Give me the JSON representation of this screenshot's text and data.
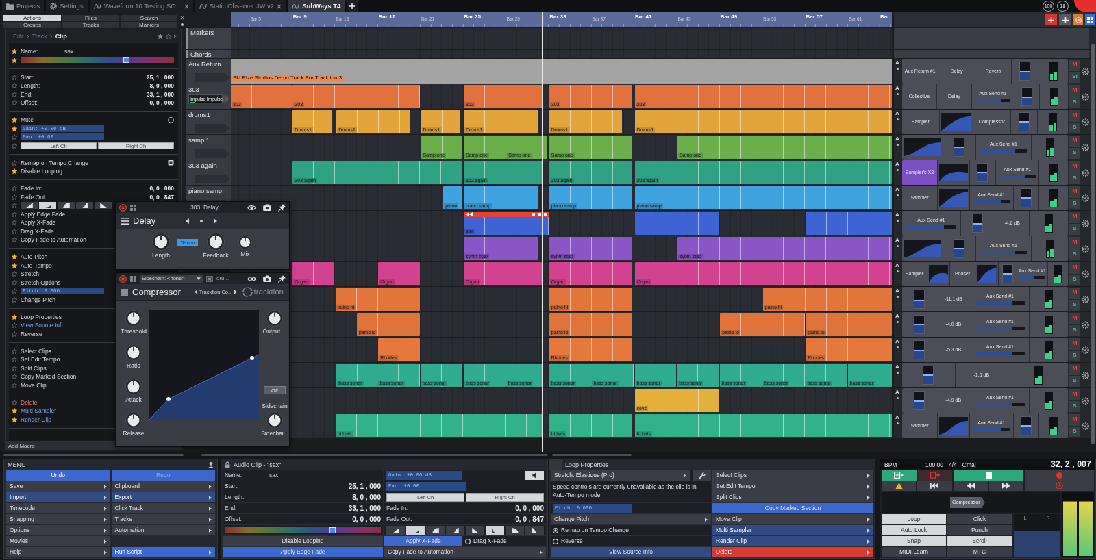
{
  "tabs_bar": {
    "tabs": [
      {
        "kind": "projects",
        "label": "Projects",
        "selected": false
      },
      {
        "kind": "settings",
        "label": "Settings",
        "selected": false
      },
      {
        "kind": "edit",
        "label": "Waveform 10 Testing SO...",
        "selected": false
      },
      {
        "kind": "edit",
        "label": "Static Observer JW v2",
        "selected": false
      },
      {
        "kind": "edit",
        "label": "SubWays T4",
        "selected": true
      }
    ],
    "badges": [
      "100",
      "18"
    ]
  },
  "left_panel": {
    "subtabs": [
      {
        "label": "Actions",
        "selected": true
      },
      {
        "label": "Files",
        "selected": false
      },
      {
        "label": "Search",
        "selected": false
      },
      {
        "label": "Groups",
        "selected": false
      },
      {
        "label": "Tracks",
        "selected": false
      },
      {
        "label": "Markers",
        "selected": false
      }
    ],
    "breadcrumb": [
      "Edit",
      "Track",
      "Clip"
    ],
    "sections": [
      [
        {
          "kind": "name",
          "starred": true,
          "label": "Name:",
          "value": "sax"
        },
        {
          "kind": "color",
          "starred": true
        }
      ],
      [
        {
          "kind": "field",
          "starred": false,
          "label": "Start:",
          "value": "25, 1 , 000"
        },
        {
          "kind": "field",
          "starred": false,
          "label": "Length:",
          "value": "8, 0 , 000"
        },
        {
          "kind": "field",
          "starred": false,
          "label": "End:",
          "value": "33, 1 , 000"
        },
        {
          "kind": "field",
          "starred": false,
          "label": "Offset:",
          "value": "0, 0 , 000"
        }
      ],
      [
        {
          "kind": "toggle",
          "starred": true,
          "label": "Mute",
          "checked": false
        },
        {
          "kind": "valuebox",
          "starred": true,
          "label": "Gain: +0.00 dB"
        },
        {
          "kind": "valuebox",
          "starred": false,
          "label": "Pan: +0.00"
        },
        {
          "kind": "channels",
          "starred": false,
          "buttons": [
            "Left Ch",
            "Right Ch"
          ]
        }
      ],
      [
        {
          "kind": "toggle",
          "starred": false,
          "label": "Remap on Tempo Change",
          "checked": true
        },
        {
          "kind": "action",
          "starred": true,
          "label": "Disable Looping"
        }
      ],
      [
        {
          "kind": "field",
          "starred": false,
          "label": "Fade In:",
          "value": "0, 0 , 000"
        },
        {
          "kind": "field",
          "starred": false,
          "label": "Fade Out:",
          "value": "0, 0 , 847"
        },
        {
          "kind": "fades",
          "starred": false,
          "shapes": [
            {
              "selected": false
            },
            {
              "selected": true
            },
            {
              "selected": false
            },
            {
              "selected": false
            },
            {
              "selected": false
            }
          ]
        },
        {
          "kind": "action",
          "starred": false,
          "label": "Apply Edge Fade"
        },
        {
          "kind": "action",
          "starred": false,
          "label": "Apply X-Fade"
        },
        {
          "kind": "action",
          "starred": false,
          "label": "Drag X-Fade"
        },
        {
          "kind": "action",
          "starred": false,
          "label": "Copy Fade to Automation"
        }
      ],
      [
        {
          "kind": "action",
          "starred": true,
          "label": "Auto-Pitch"
        },
        {
          "kind": "action",
          "starred": true,
          "label": "Auto-Tempo"
        },
        {
          "kind": "action",
          "starred": false,
          "label": "Stretch"
        },
        {
          "kind": "action",
          "starred": false,
          "label": "Stretch Options"
        },
        {
          "kind": "valuebox",
          "starred": false,
          "label": "Pitch: 0.000"
        },
        {
          "kind": "action",
          "starred": false,
          "label": "Change Pitch"
        }
      ],
      [
        {
          "kind": "action",
          "starred": true,
          "label": "Loop Properties"
        },
        {
          "kind": "link",
          "starred": false,
          "label": "View Source Info"
        },
        {
          "kind": "action",
          "starred": false,
          "label": "Reverse"
        }
      ],
      [
        {
          "kind": "action",
          "starred": false,
          "label": "Select Clips"
        },
        {
          "kind": "action",
          "starred": false,
          "label": "Set Edit Tempo"
        },
        {
          "kind": "action",
          "starred": false,
          "label": "Split Clips"
        },
        {
          "kind": "action",
          "starred": false,
          "label": "Copy Marked Section"
        },
        {
          "kind": "action",
          "starred": false,
          "label": "Move Clip"
        }
      ],
      [
        {
          "kind": "danger",
          "starred": false,
          "label": "Delete"
        },
        {
          "kind": "link",
          "starred": true,
          "label": "Multi Sampler"
        },
        {
          "kind": "link",
          "starred": true,
          "label": "Render Clip"
        }
      ]
    ],
    "footer": "Add Macro"
  },
  "arrangement": {
    "ruler": [
      {
        "label": "Bar 5",
        "major": false
      },
      {
        "label": "Bar 9",
        "major": true
      },
      {
        "label": "Bar 13",
        "major": false
      },
      {
        "label": "Bar 17",
        "major": true
      },
      {
        "label": "Bar 21",
        "major": false
      },
      {
        "label": "Bar 25",
        "major": true
      },
      {
        "label": "Bar 29",
        "major": false
      },
      {
        "label": "Bar 33",
        "major": true
      },
      {
        "label": "Bar 37",
        "major": false
      },
      {
        "label": "Bar 41",
        "major": true
      },
      {
        "label": "Bar 45",
        "major": false
      },
      {
        "label": "Bar 49",
        "major": true
      },
      {
        "label": "Bar 53",
        "major": false
      },
      {
        "label": "Bar 57",
        "major": true
      },
      {
        "label": "Bar 61",
        "major": false
      },
      {
        "label": "Bar",
        "major": true
      }
    ],
    "tracks": [
      {
        "kind": "markers",
        "name": "Markers"
      },
      {
        "kind": "chords",
        "name": "Chords"
      },
      {
        "kind": "aux",
        "name": "Aux Return",
        "color": "#a4a4a4",
        "banner": "Ski Rize Studios Demo Track For Tracktion 3",
        "mixer": {
          "automation": "A",
          "slots": [
            {
              "kind": "plugin",
              "label": "Aux Return #1"
            },
            {
              "kind": "plugin",
              "label": "Delay"
            },
            {
              "kind": "plugin",
              "label": "Reverb"
            },
            {
              "kind": "fader",
              "level": 0.55
            },
            {
              "kind": "meter"
            }
          ],
          "mute": "M",
          "solo": "SI"
        }
      },
      {
        "kind": "audio",
        "name": "303",
        "input": "Impulse Impulse",
        "color": "#e2713d",
        "clips": [
          {
            "label": "303",
            "selected": false
          },
          {
            "label": "303",
            "selected": false
          },
          {
            "label": "303",
            "selected": false
          },
          {
            "label": "303",
            "selected": false
          },
          {
            "label": "303",
            "selected": false
          }
        ],
        "mixer": {
          "automation": "A",
          "slots": [
            {
              "kind": "plugin",
              "label": "Collective"
            },
            {
              "kind": "plugin",
              "label": "Delay"
            },
            {
              "kind": "send",
              "label": "Aux Send #1",
              "level": 0.75
            },
            {
              "kind": "fader",
              "level": 0.5
            },
            {
              "kind": "meter"
            }
          ],
          "mute": "M",
          "solo": "S"
        }
      },
      {
        "kind": "audio",
        "name": "drums1",
        "color": "#e3a43c",
        "clips": [
          {
            "label": "Drums1",
            "selected": false
          },
          {
            "label": "Drums1",
            "selected": false
          },
          {
            "label": "Drums1",
            "selected": false
          },
          {
            "label": "Drums1",
            "selected": false
          },
          {
            "label": "Drums1",
            "selected": false
          },
          {
            "label": "Drums1",
            "selected": false
          }
        ],
        "mixer": {
          "automation": "A",
          "slots": [
            {
              "kind": "plugin",
              "label": "Sampler"
            },
            {
              "kind": "graph"
            },
            {
              "kind": "plugin",
              "label": "Compressor"
            },
            {
              "kind": "fader",
              "level": 0.55
            },
            {
              "kind": "meter"
            }
          ],
          "mute": "M",
          "solo": "S"
        }
      },
      {
        "kind": "audio",
        "name": "samp 1",
        "color": "#6cae4a",
        "clips": [
          {
            "label": "Samp one",
            "selected": false
          },
          {
            "label": "Samp one",
            "selected": false
          },
          {
            "label": "Samp one",
            "selected": false
          },
          {
            "label": "Samp one",
            "selected": false
          },
          {
            "label": "Samp one",
            "selected": false
          }
        ],
        "mixer": {
          "automation": "A",
          "slots": [
            {
              "kind": "graph"
            },
            {
              "kind": "fader",
              "level": 0.55
            },
            {
              "kind": "send",
              "label": "Aux Send #1",
              "level": 0.75
            },
            {
              "kind": "meter"
            }
          ],
          "mute": "M",
          "solo": "S"
        }
      },
      {
        "kind": "audio",
        "name": "303 again",
        "color": "#2fa283",
        "clips": [
          {
            "label": "303 again",
            "selected": false
          },
          {
            "label": "303 again",
            "selected": false
          },
          {
            "label": "303 again",
            "selected": false
          },
          {
            "label": "303 again",
            "selected": false
          }
        ],
        "mixer": {
          "automation": "A",
          "slots": [
            {
              "kind": "plugin",
              "label": "Sampler's X3",
              "color": "#7d4fc4"
            },
            {
              "kind": "graph"
            },
            {
              "kind": "fader",
              "level": 0.55
            },
            {
              "kind": "send",
              "label": "Aux Send #1",
              "level": 0.7
            },
            {
              "kind": "meter"
            }
          ],
          "mute": "M",
          "solo": "S"
        }
      },
      {
        "kind": "audio",
        "name": "piano samp",
        "color": "#3ea3df",
        "clips": [
          {
            "label": "piano",
            "selected": false
          },
          {
            "label": "piano samp",
            "selected": false
          },
          {
            "label": "piano samp",
            "selected": false
          },
          {
            "label": "piano samp",
            "selected": false
          }
        ],
        "mixer": {
          "automation": "A",
          "slots": [
            {
              "kind": "plugin",
              "label": "Sampler"
            },
            {
              "kind": "graph"
            },
            {
              "kind": "send",
              "label": "Aux Send #1",
              "level": 0.75
            },
            {
              "kind": "fader",
              "level": 0.55
            },
            {
              "kind": "meter"
            }
          ],
          "mute": "M",
          "solo": "S"
        }
      },
      {
        "kind": "audio",
        "color": "#3d63d4",
        "clips": [
          {
            "label": "sax",
            "selected": true
          },
          {
            "selected": false
          },
          {
            "selected": false
          }
        ],
        "mixer": {
          "automation": "A",
          "slots": [
            {
              "kind": "send",
              "label": "Aux Send #1",
              "level": 0.75
            },
            {
              "kind": "fader",
              "level": 0.5
            },
            {
              "kind": "reading",
              "label": "-4.6 dB"
            },
            {
              "kind": "meter"
            }
          ],
          "mute": "M",
          "solo": "S"
        }
      },
      {
        "kind": "audio",
        "color": "#8a55c6",
        "clips": [
          {
            "label": "synth stab",
            "selected": false
          },
          {
            "label": "synth stab",
            "selected": false
          },
          {
            "label": "synth stab",
            "selected": false
          }
        ],
        "mixer": {
          "automation": "A",
          "slots": [
            {
              "kind": "graph"
            },
            {
              "kind": "fader",
              "level": 0.55
            },
            {
              "kind": "send",
              "label": "Aux Send #1",
              "level": 0.75
            },
            {
              "kind": "meter"
            }
          ],
          "mute": "M",
          "solo": "S"
        }
      },
      {
        "kind": "audio",
        "color": "#d3428e",
        "clips": [
          {
            "label": "Organ",
            "selected": false
          },
          {
            "label": "Organ",
            "selected": false
          },
          {
            "label": "Organ",
            "selected": false
          },
          {
            "label": "Organ",
            "selected": false
          },
          {
            "label": "Organ",
            "selected": false
          }
        ],
        "mixer": {
          "automation": "A",
          "slots": [
            {
              "kind": "plugin",
              "label": "Sampler"
            },
            {
              "kind": "graph"
            },
            {
              "kind": "plugin",
              "label": "Phaser"
            },
            {
              "kind": "graph"
            },
            {
              "kind": "fader",
              "level": 0.55
            },
            {
              "kind": "send",
              "label": "Aux Send #1",
              "level": 0.6
            },
            {
              "kind": "meter"
            }
          ],
          "mute": "M",
          "solo": "S"
        }
      },
      {
        "kind": "audio",
        "color": "#e3753b",
        "clips": [
          {
            "label": "paino hi",
            "selected": false
          },
          {
            "label": "paino hi",
            "selected": false
          },
          {
            "label": "paino hi",
            "selected": false
          }
        ],
        "mixer": {
          "automation": "A",
          "slots": [
            {
              "kind": "fader",
              "level": 0.45
            },
            {
              "kind": "reading",
              "label": "-11.1 dB"
            },
            {
              "kind": "send",
              "label": "Aux Send #1",
              "level": 0.75
            },
            {
              "kind": "meter"
            }
          ],
          "mute": "M",
          "solo": "S"
        }
      },
      {
        "kind": "audio",
        "color": "#e0733a",
        "clips": [
          {
            "label": "paino lo",
            "selected": false
          },
          {
            "label": "paino lo",
            "selected": false
          },
          {
            "label": "paino lo",
            "selected": false
          },
          {
            "label": "paino lo",
            "selected": false
          }
        ],
        "mixer": {
          "automation": "A",
          "slots": [
            {
              "kind": "fader",
              "level": 0.55
            },
            {
              "kind": "reading",
              "label": "-4.0 dB"
            },
            {
              "kind": "send",
              "label": "Aux Send #1",
              "level": 0.75
            },
            {
              "kind": "meter"
            }
          ],
          "mute": "M",
          "solo": "S"
        }
      },
      {
        "kind": "audio",
        "color": "#e5783d",
        "clips": [
          {
            "label": "Rhodes",
            "selected": false
          },
          {
            "label": "Rhodes",
            "selected": false
          },
          {
            "label": "Rhodes",
            "selected": false
          }
        ],
        "mixer": {
          "automation": "A",
          "slots": [
            {
              "kind": "fader",
              "level": 0.5
            },
            {
              "kind": "reading",
              "label": "-5.3 dB"
            },
            {
              "kind": "send",
              "label": "Aux Send #1",
              "level": 0.75
            },
            {
              "kind": "meter"
            }
          ],
          "mute": "M",
          "solo": "S"
        }
      },
      {
        "kind": "audio",
        "color": "#2fab8f",
        "clips": [
          {
            "label": "bass sonar",
            "selected": false
          },
          {
            "label": "bass sonar",
            "selected": false
          },
          {
            "label": "bass sonar",
            "selected": false
          },
          {
            "label": "bass sonar",
            "selected": false
          },
          {
            "label": "bass sonar",
            "selected": false
          },
          {
            "label": "bass sonar",
            "selected": false
          },
          {
            "label": "bass sonar",
            "selected": false
          },
          {
            "label": "bass sonar",
            "selected": false
          },
          {
            "label": "bass sonar",
            "selected": false
          },
          {
            "label": "bass sonar",
            "selected": false
          },
          {
            "label": "bass sonar",
            "selected": false
          },
          {
            "label": "bass sonar",
            "selected": false
          },
          {
            "label": "bass sonar",
            "selected": false
          }
        ],
        "mixer": {
          "automation": "A",
          "slots": [
            {
              "kind": "fader",
              "level": 0.55
            },
            {
              "kind": "reading",
              "label": "-1.5 dB"
            },
            {
              "kind": "meter"
            }
          ],
          "mute": "M",
          "solo": "S"
        }
      },
      {
        "kind": "audio",
        "color": "#e3b03c",
        "clips": [
          {
            "label": "keys",
            "selected": false
          }
        ],
        "mixer": {
          "automation": "A",
          "slots": [
            {
              "kind": "fader",
              "level": 0.5
            },
            {
              "kind": "reading",
              "label": "-4.9 dB"
            },
            {
              "kind": "send",
              "label": "Aux Send #1",
              "level": 0.75
            },
            {
              "kind": "meter"
            }
          ],
          "mute": "M",
          "solo": "S"
        }
      },
      {
        "kind": "audio",
        "color": "#31b188",
        "clips": [
          {
            "label": "hi hats",
            "selected": false
          },
          {
            "label": "hi hats",
            "selected": false
          },
          {
            "label": "hi hats",
            "selected": false
          }
        ],
        "mixer": {
          "automation": "A",
          "slots": [
            {
              "kind": "plugin",
              "label": "Sampler"
            },
            {
              "kind": "graph"
            },
            {
              "kind": "send",
              "label": "Aux Send #1",
              "level": 0.75
            },
            {
              "kind": "fader",
              "level": 0.55
            },
            {
              "kind": "meter"
            }
          ],
          "mute": "M",
          "solo": "S"
        }
      }
    ]
  },
  "plugins": [
    {
      "kind": "delay",
      "header": "303: Delay",
      "title": "Delay",
      "tempo_button": "Tempo",
      "knobs": [
        {
          "label": "Length"
        },
        {
          "label": "Feedback"
        },
        {
          "label": "Mix"
        }
      ]
    },
    {
      "kind": "compressor",
      "sidechain": "Sidechain: <none>",
      "source": "dru...",
      "title": "Compressor",
      "preset": "Tracktion Co...",
      "brand": "tracktion",
      "switch": "Off",
      "switch_label": "Sidechain",
      "knobs": [
        {
          "label": "Threshold"
        },
        {
          "label": "Ratio"
        },
        {
          "label": "Attack"
        },
        {
          "label": "Release"
        },
        {
          "label": "Output ..."
        },
        {
          "label": "Sidechai..."
        }
      ]
    }
  ],
  "menu_panel": {
    "title": "MENU",
    "items": [
      {
        "kind": "button",
        "label": "Undo",
        "color": "#3c67cc",
        "disabled": false
      },
      {
        "kind": "button",
        "label": "Redo",
        "color": "#3c67cc",
        "disabled": true
      },
      {
        "kind": "submenu",
        "label": "Save",
        "disabled": false
      },
      {
        "kind": "submenu",
        "label": "Clipboard",
        "disabled": false
      },
      {
        "kind": "submenu",
        "label": "Import",
        "color": "#314c83",
        "disabled": false
      },
      {
        "kind": "submenu",
        "label": "Export",
        "color": "#314c83",
        "disabled": false
      },
      {
        "kind": "submenu",
        "label": "Timecode",
        "disabled": false
      },
      {
        "kind": "submenu",
        "label": "Click Track",
        "disabled": false
      },
      {
        "kind": "submenu",
        "label": "Snapping",
        "disabled": false
      },
      {
        "kind": "submenu",
        "label": "Tracks",
        "disabled": false
      },
      {
        "kind": "submenu",
        "label": "Options",
        "disabled": false
      },
      {
        "kind": "submenu",
        "label": "Automation",
        "disabled": false
      },
      {
        "kind": "submenu",
        "label": "Movies",
        "disabled": false
      },
      {
        "kind": "blank"
      },
      {
        "kind": "submenu",
        "label": "Help",
        "disabled": false
      },
      {
        "kind": "submenu",
        "label": "Run Script",
        "color": "#3c67cc",
        "disabled": false
      }
    ]
  },
  "clip_panel": {
    "title": "Audio Clip - \"sax\"",
    "left": [
      {
        "kind": "name",
        "label": "Name:",
        "value": "sax"
      },
      {
        "kind": "field",
        "label": "Start:",
        "value": "25, 1 , 000"
      },
      {
        "kind": "field",
        "label": "Length:",
        "value": "8, 0 , 000"
      },
      {
        "kind": "field",
        "label": "End:",
        "value": "33, 1 , 000"
      },
      {
        "kind": "field",
        "label": "Offset:",
        "value": "0, 0 , 000"
      },
      {
        "kind": "color"
      },
      {
        "kind": "button",
        "label": "Disable Looping"
      },
      {
        "kind": "button",
        "label": "Apply Edge Fade",
        "color": "#3c67cc"
      }
    ],
    "right": [
      {
        "kind": "valuebox",
        "label": "Gain: +0.00 dB",
        "speaker": true
      },
      {
        "kind": "valuebox",
        "label": "Pan: +0.00"
      },
      {
        "kind": "channels",
        "buttons": [
          "Left Ch",
          "Right Ch"
        ]
      },
      {
        "kind": "field",
        "label": "Fade In:",
        "value": "0, 0 , 000"
      },
      {
        "kind": "field",
        "label": "Fade Out:",
        "value": "0, 0 , 847"
      },
      {
        "kind": "fades",
        "shapes": [
          {
            "selected": false
          },
          {
            "selected": true
          },
          {
            "selected": false
          },
          {
            "selected": false
          },
          {
            "selected": false
          },
          {
            "selected": true
          },
          {
            "selected": false
          },
          {
            "selected": false
          }
        ]
      },
      {
        "kind": "xfade",
        "button": "Apply X-Fade",
        "color": "#3c67cc",
        "radio": "Drag X-Fade",
        "checked": false
      },
      {
        "kind": "submenu",
        "label": "Copy Fade to Automation"
      }
    ]
  },
  "loop_panel": {
    "title": "Loop Properties",
    "left": [
      {
        "kind": "dropdown",
        "label": "Stretch: Elastique (Pro)"
      },
      {
        "kind": "note",
        "text": "Speed controls are currently unavailable as the clip is in Auto-Tempo mode"
      },
      {
        "kind": "valuebox",
        "label": "Pitch: 0.000"
      },
      {
        "kind": "submenu",
        "label": "Change Pitch"
      },
      {
        "kind": "radio",
        "label": "Remap on Tempo Change",
        "checked": true
      },
      {
        "kind": "radio",
        "label": "Reverse",
        "checked": false
      },
      {
        "kind": "button",
        "label": "View Source Info",
        "color": "#314c83"
      }
    ],
    "right": [
      {
        "kind": "submenu",
        "label": "Select Clips"
      },
      {
        "kind": "submenu",
        "label": "Set Edit Tempo"
      },
      {
        "kind": "submenu",
        "label": "Split Clips"
      },
      {
        "kind": "button",
        "label": "Copy Marked Section",
        "color": "#3c67cc"
      },
      {
        "kind": "submenu",
        "label": "Move Clip"
      },
      {
        "kind": "submenu",
        "label": "Multi Sampler",
        "color": "#314c83"
      },
      {
        "kind": "submenu",
        "label": "Render Clip",
        "color": "#314c83"
      },
      {
        "kind": "submenu",
        "label": "Delete",
        "color": "#d83a35"
      }
    ]
  },
  "transport": {
    "bpm_label": "BPM",
    "tempo": "100.00",
    "time_signature": "4/4",
    "key": "Cmaj",
    "position": "32, 2 , 007",
    "plugin": "Compressor",
    "toggles": [
      {
        "label": "Loop",
        "on": true
      },
      {
        "label": "Click",
        "on": false
      },
      {
        "label": "Auto Lock",
        "on": true
      },
      {
        "label": "Punch",
        "on": false
      },
      {
        "label": "Snap",
        "on": true
      },
      {
        "label": "Scroll",
        "on": true
      },
      {
        "label": "MIDI Learn",
        "on": false
      },
      {
        "label": "MTC",
        "on": false
      }
    ],
    "pan_labels": [
      "L",
      "R"
    ]
  }
}
